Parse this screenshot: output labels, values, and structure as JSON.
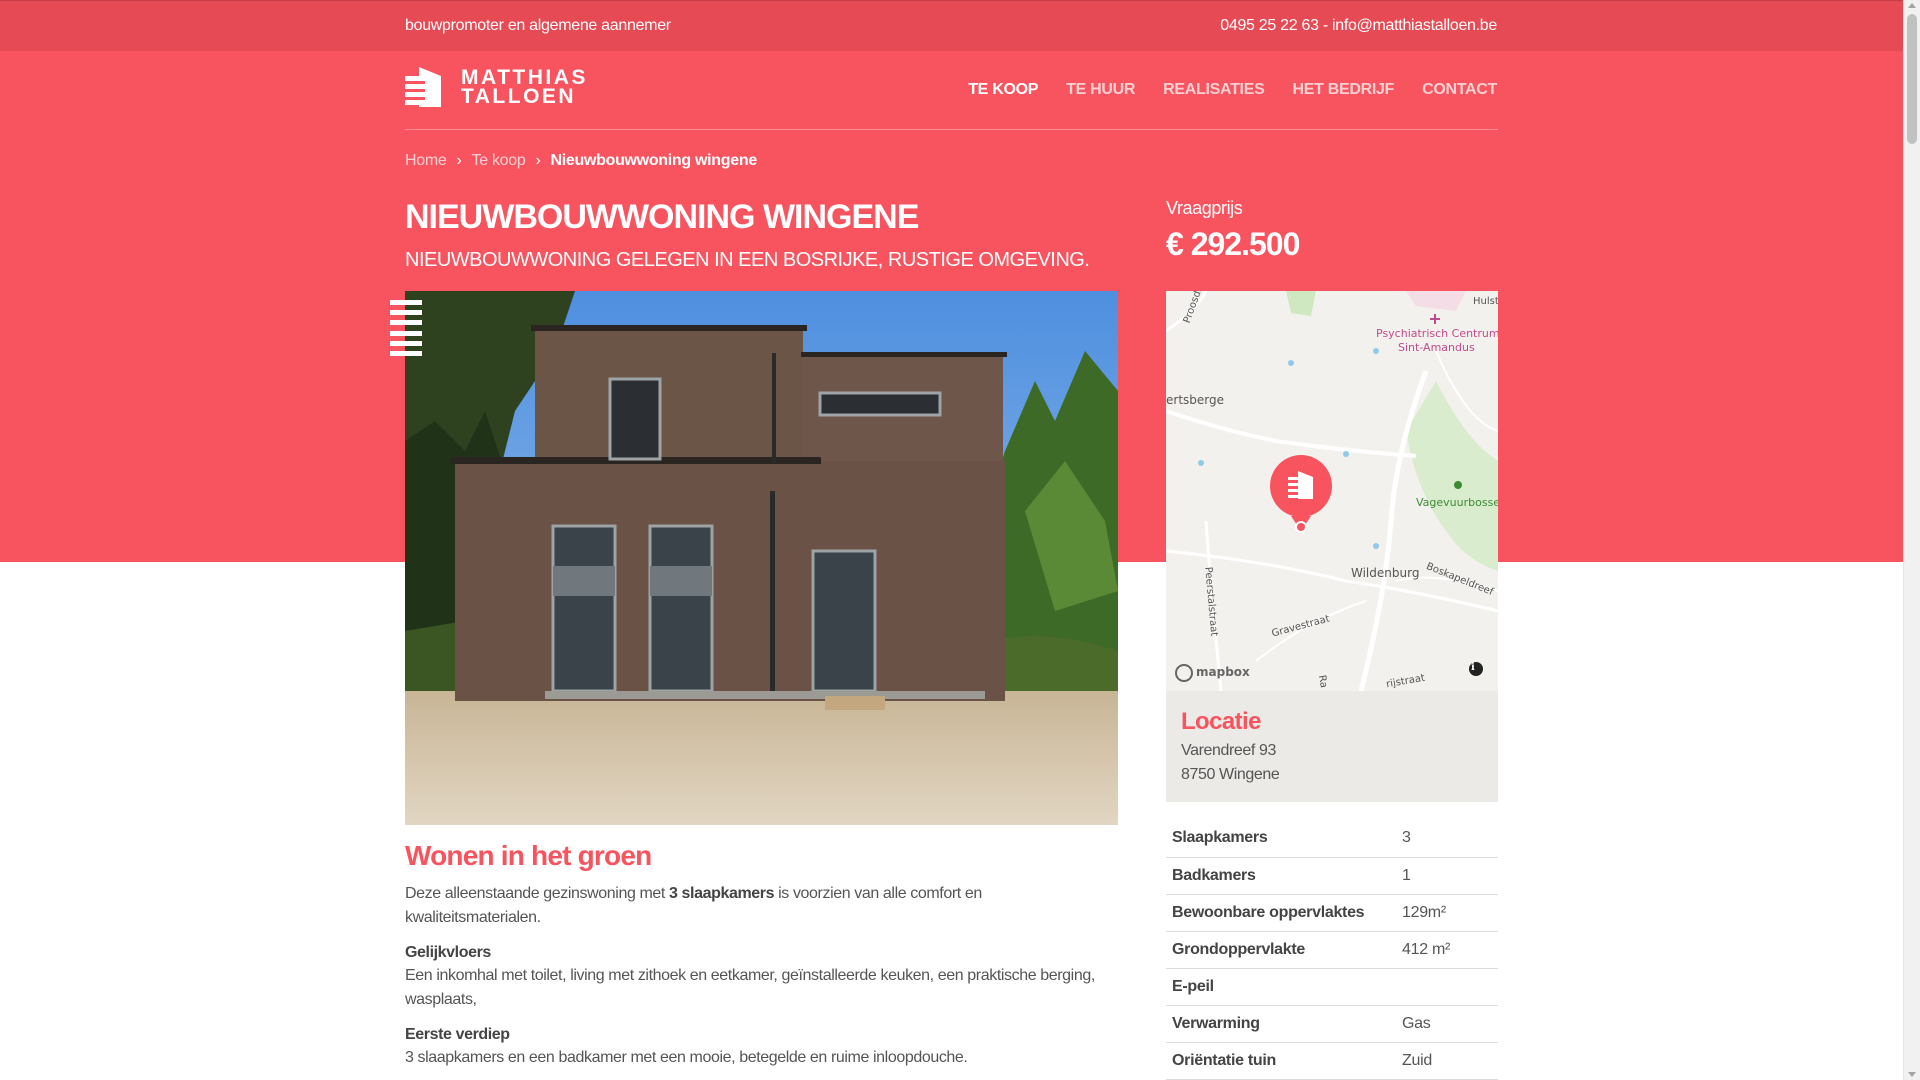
{
  "topbar": {
    "tagline": "bouwpromoter en algemene aannemer",
    "contact": "0495 25 22 63 - info@matthiastalloen.be"
  },
  "logo": {
    "line1": "MATTHIAS",
    "line2": "TALLOEN"
  },
  "nav": [
    {
      "label": "TE KOOP",
      "active": true
    },
    {
      "label": "TE HUUR"
    },
    {
      "label": "REALISATIES"
    },
    {
      "label": "HET BEDRIJF"
    },
    {
      "label": "CONTACT"
    }
  ],
  "breadcrumb": {
    "home": "Home",
    "sep": "›",
    "section": "Te koop",
    "current": "Nieuwbouwwoning wingene"
  },
  "property": {
    "title": "NIEUWBOUWWONING WINGENE",
    "subtitle": "NIEUWBOUWWONING GELEGEN IN EEN BOSRIJKE, RUSTIGE OMGEVING.",
    "price_label": "Vraagprijs",
    "price": "€ 292.500"
  },
  "map": {
    "labels": {
      "proosdij": "Proosdij",
      "hulst": "Hulst",
      "psych1": "Psychiatrisch Centrum",
      "psych2": "Sint-Amandus",
      "ertsberge": "ertsberge",
      "vagevuur": "Vagevuurbossen",
      "wildenburg": "Wildenburg",
      "boskapel": "Boskapeldreef",
      "peerstal": "Peerstalstraat",
      "gravestraat": "Gravestraat",
      "mapbox": "mapbox",
      "rstraat": "rijstraat",
      "ra": "Ra"
    }
  },
  "location": {
    "heading": "Locatie",
    "street": "Varendreef 93",
    "city": "8750 Wingene"
  },
  "specs": [
    {
      "k": "Slaapkamers",
      "v": "3"
    },
    {
      "k": "Badkamers",
      "v": "1"
    },
    {
      "k": "Bewoonbare oppervlaktes",
      "v": "129m²"
    },
    {
      "k": "Grondoppervlakte",
      "v": "412 m²"
    },
    {
      "k": "E-peil",
      "v": ""
    },
    {
      "k": "Verwarming",
      "v": "Gas"
    },
    {
      "k": "Oriëntatie tuin",
      "v": "Zuid"
    }
  ],
  "content": {
    "heading": "Wonen in het groen",
    "intro_pre": "Deze alleenstaande gezinswoning met ",
    "intro_bold": "3 slaapkamers",
    "intro_post": " is voorzien van alle comfort en kwaliteitsmaterialen.",
    "floor1_title": "Gelijkvloers",
    "floor1_text": "Een inkomhal met toilet, living met zithoek en eetkamer, geïnstalleerde keuken, een praktische berging, wasplaats,",
    "floor2_title": "Eerste verdiep",
    "floor2_text": "3 slaapkamers en een badkamer met een mooie, betegelde en ruime inloopdouche."
  },
  "colors": {
    "brand": "#f7545f",
    "topbar": "#e64a55"
  }
}
